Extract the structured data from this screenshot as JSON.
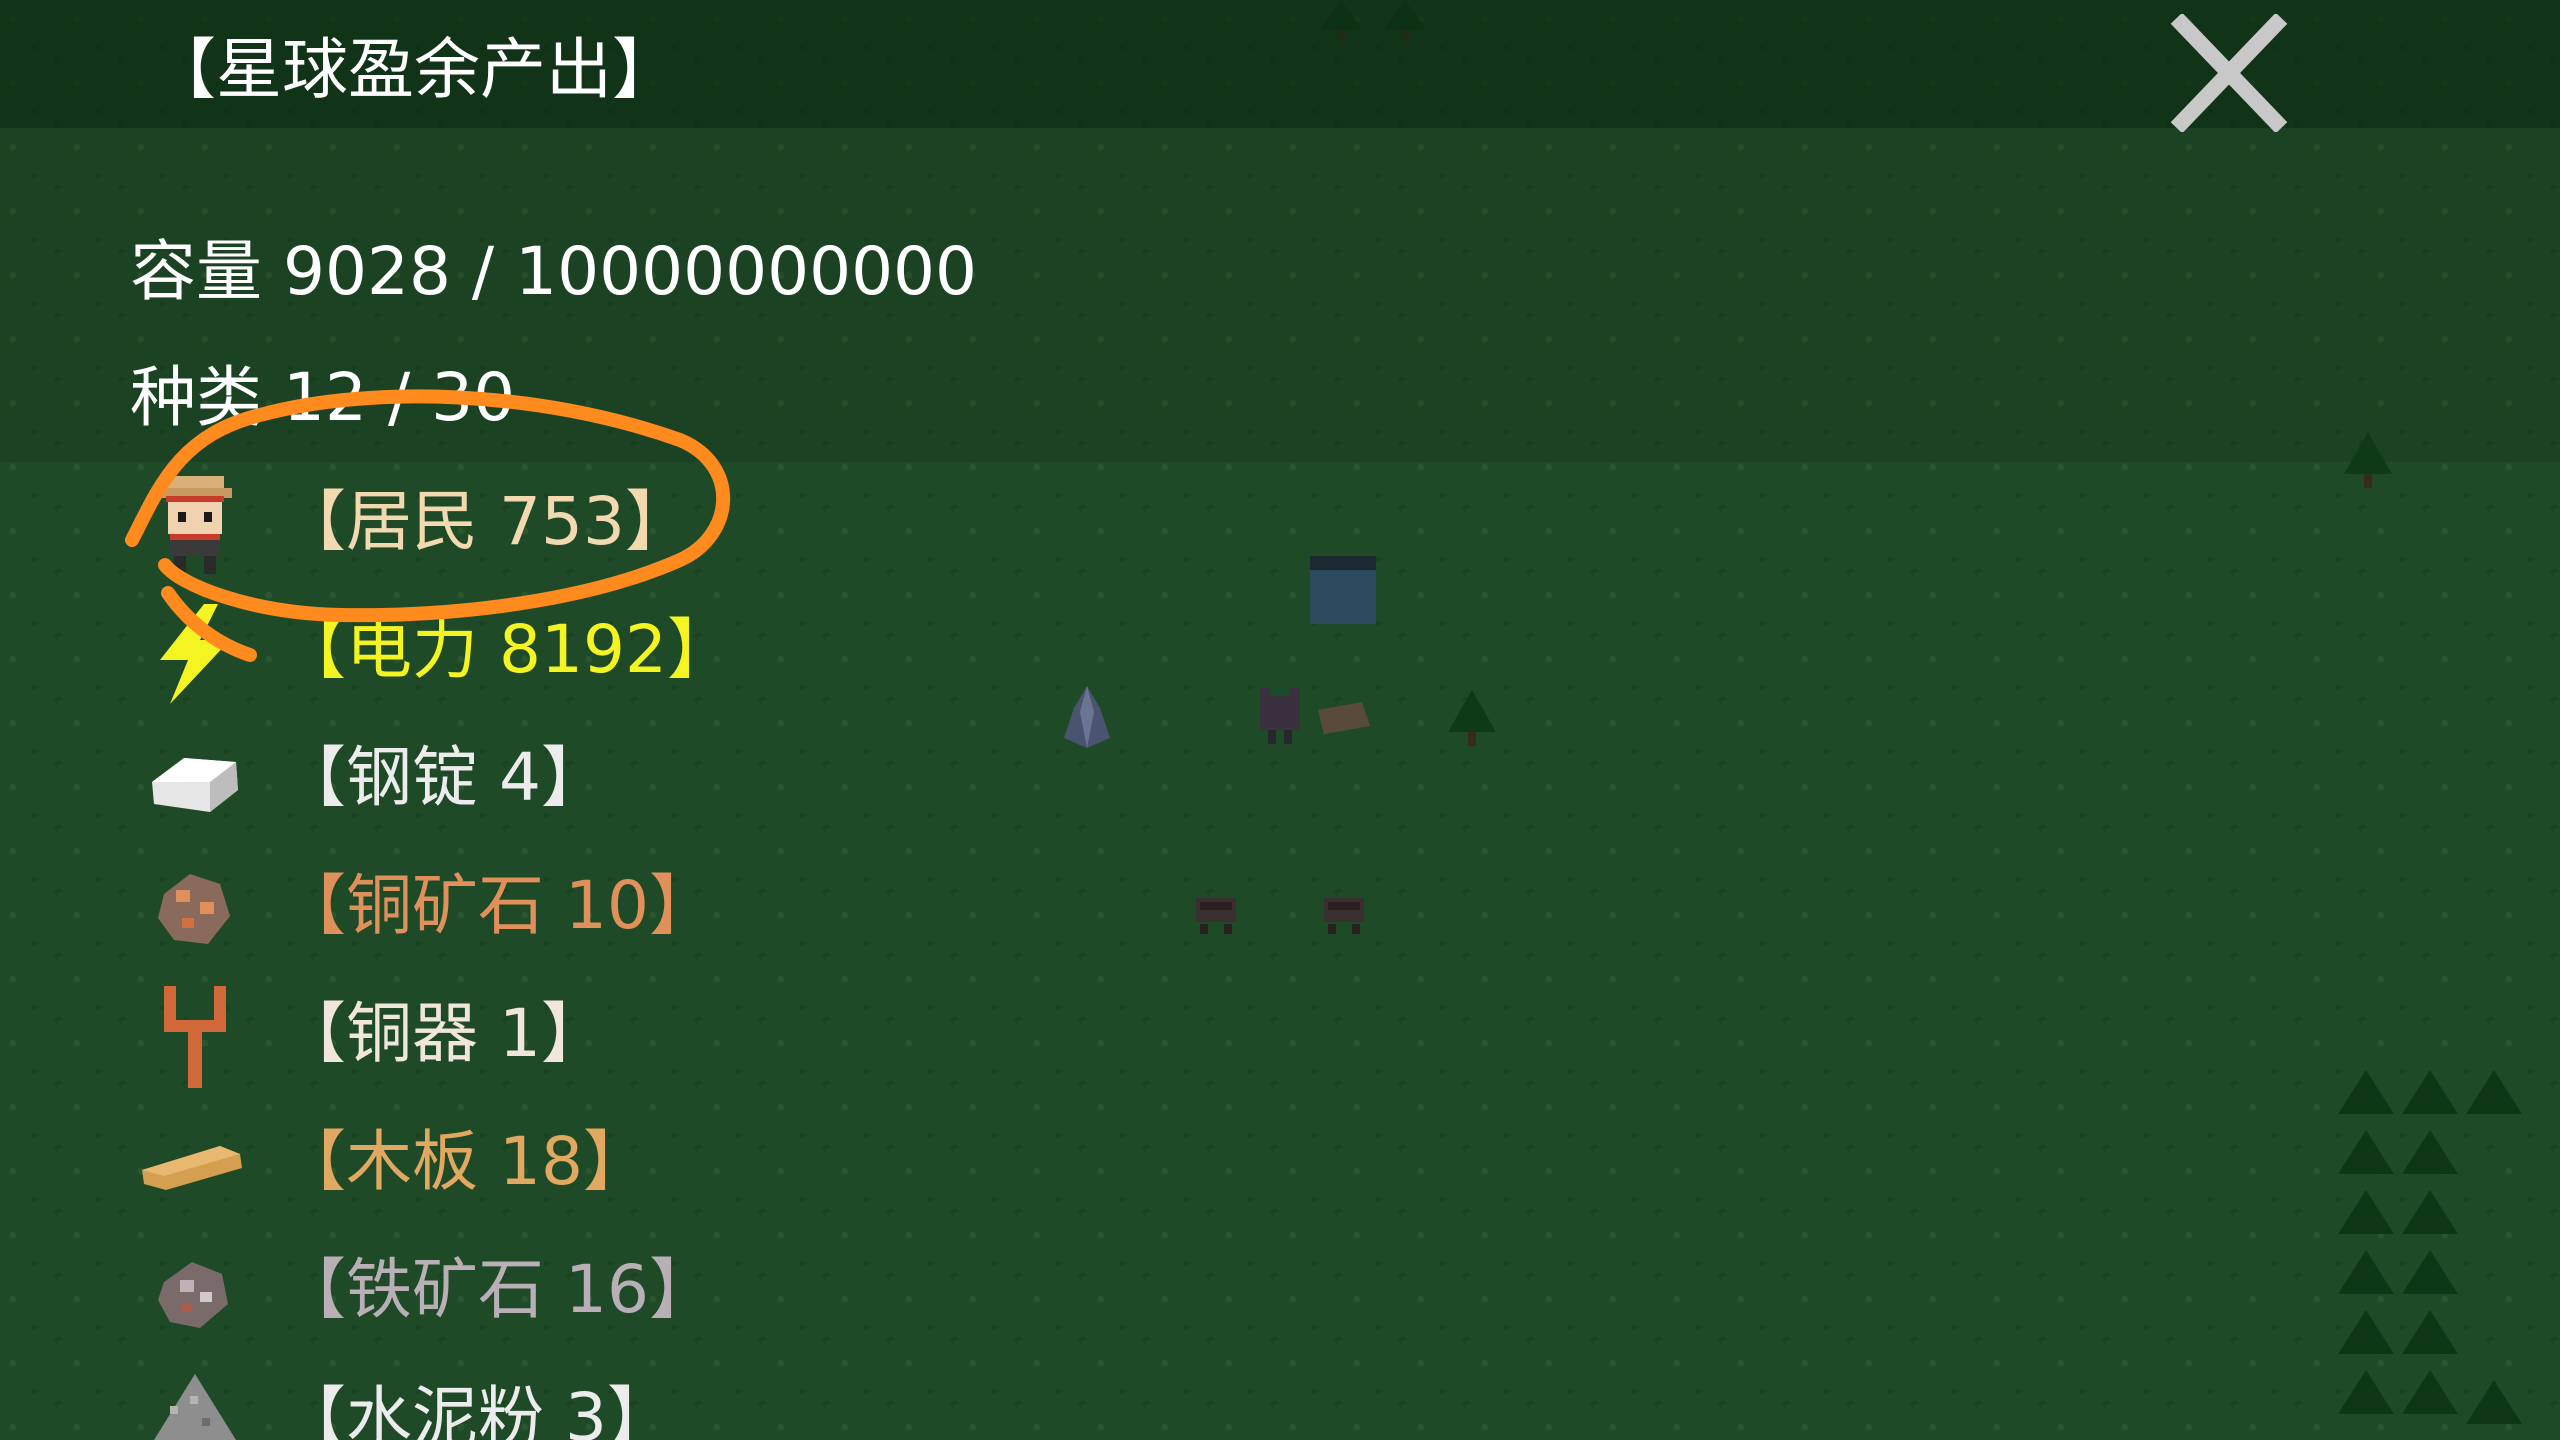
{
  "panel": {
    "title": "【星球盈余产出】",
    "capacity": "容量 9028 / 10000000000",
    "types": "种类 12 / 30"
  },
  "resources": [
    {
      "label": "【居民 753】",
      "color": "#f2d9b0",
      "icon": "resident-icon"
    },
    {
      "label": "【电力 8192】",
      "color": "#f4f422",
      "icon": "lightning-icon"
    },
    {
      "label": "【钢锭 4】",
      "color": "#ececec",
      "icon": "steel-ingot-icon"
    },
    {
      "label": "【铜矿石 10】",
      "color": "#e0905a",
      "icon": "copper-ore-icon"
    },
    {
      "label": "【铜器 1】",
      "color": "#f0e6dc",
      "icon": "copper-tool-icon"
    },
    {
      "label": "【木板 18】",
      "color": "#e0a860",
      "icon": "wood-plank-icon"
    },
    {
      "label": "【铁矿石 16】",
      "color": "#b8b0b6",
      "icon": "iron-ore-icon"
    },
    {
      "label": "【水泥粉 3】",
      "color": "#ececec",
      "icon": "cement-powder-icon"
    }
  ],
  "colors": {
    "grass": "#1f4a28",
    "annotation": "#ff8a1e",
    "close": "#c8c8c8"
  }
}
